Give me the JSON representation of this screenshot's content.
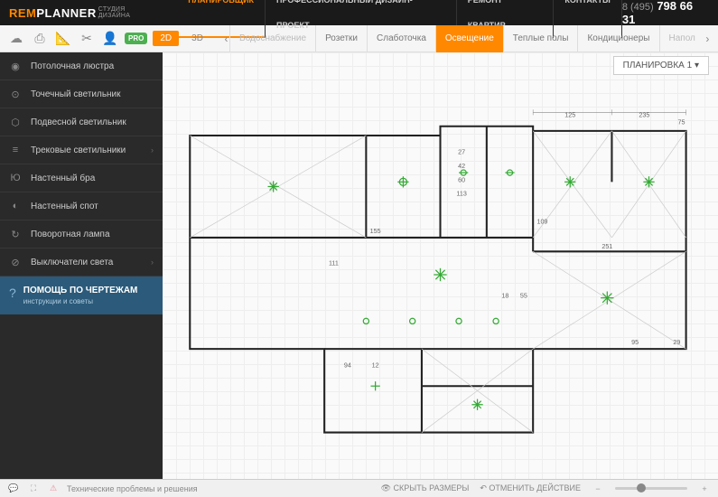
{
  "header": {
    "logo_rem": "REM",
    "logo_planner": "PLANNER",
    "logo_sub": "СТУДИЯ ДИЗАЙНА",
    "nav": [
      "ПЛАНИРОВЩИК",
      "ПРОФЕССИОНАЛЬНЫЙ ДИЗАЙН-ПРОЕКТ",
      "РЕМОНТ КВАРТИР",
      "КОНТАКТЫ"
    ],
    "phone_code": "8 (495)",
    "phone_num": " 798 66 31"
  },
  "toolbar": {
    "pro": "PRO",
    "view2d": "2D",
    "view3d": "3D",
    "categories": [
      "Водоснабжение",
      "Розетки",
      "Слаботочка",
      "Освещение",
      "Теплые полы",
      "Кондиционеры",
      "Напол"
    ]
  },
  "sidebar": {
    "items": [
      {
        "label": "Потолочная люстра"
      },
      {
        "label": "Точечный светильник"
      },
      {
        "label": "Подвесной светильник"
      },
      {
        "label": "Трековые светильники",
        "arrow": true
      },
      {
        "label": "Настенный бра"
      },
      {
        "label": "Настенный спот"
      },
      {
        "label": "Поворотная лампа"
      },
      {
        "label": "Выключатели света",
        "arrow": true
      }
    ],
    "help_title": "ПОМОЩЬ ПО ЧЕРТЕЖАМ",
    "help_sub": "инструкции и советы"
  },
  "canvas": {
    "plan_label": "ПЛАНИРОВКА 1",
    "dims": {
      "d125": "125",
      "d235": "235",
      "d75": "75",
      "d155": "155",
      "d109": "109",
      "d251": "251",
      "d111": "111",
      "d18": "18",
      "d55": "55",
      "d95": "95",
      "d29": "29",
      "d94": "94",
      "d12": "12",
      "d27": "27",
      "d42": "42",
      "d60": "60",
      "d113": "113"
    }
  },
  "status": {
    "tech": "Технические проблемы и решения",
    "hide_dims": "СКРЫТЬ РАЗМЕРЫ",
    "undo": "ОТМЕНИТЬ ДЕЙСТВИЕ"
  }
}
